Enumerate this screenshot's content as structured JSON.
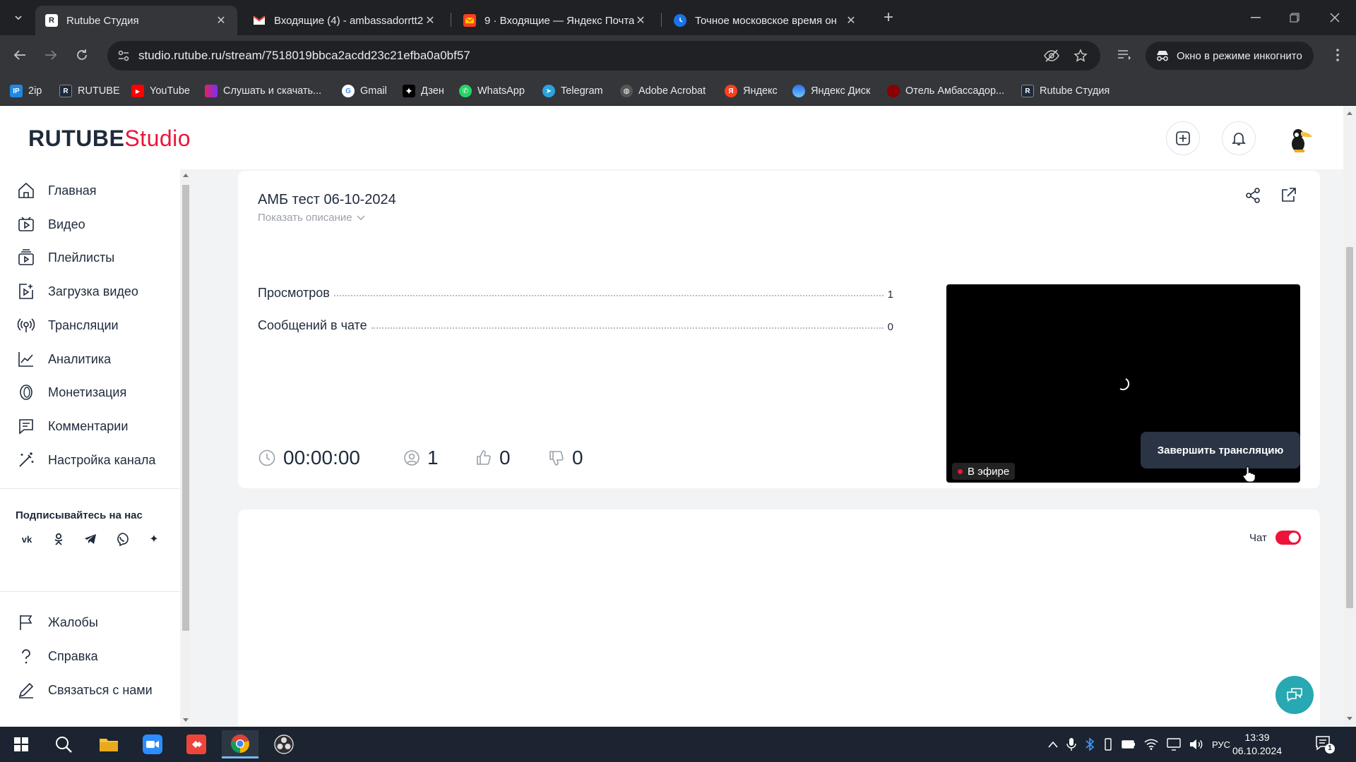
{
  "browser": {
    "tabs": [
      {
        "title": "Rutube Студия",
        "active": true
      },
      {
        "title": "Входящие (4) - ambassadorrtt2",
        "active": false
      },
      {
        "title": "9 · Входящие — Яндекс Почта",
        "active": false
      },
      {
        "title": "Точное московское время он",
        "active": false
      }
    ],
    "url": "studio.rutube.ru/stream/7518019bbca2acdd23c21efba0a0bf57",
    "incognito_label": "Окно в режиме инкогнито",
    "bookmarks": [
      "2ip",
      "RUTUBE",
      "YouTube",
      "Слушать и скачать...",
      "Gmail",
      "Дзен",
      "WhatsApp",
      "Telegram",
      "Adobe Acrobat",
      "Яндекс",
      "Яндекс Диск",
      "Отель Амбассадор...",
      "Rutube Студия"
    ]
  },
  "header": {
    "logo_main": "RUTUBE",
    "logo_accent": "Studio"
  },
  "sidebar": {
    "items": [
      {
        "label": "Главная",
        "icon": "home-icon"
      },
      {
        "label": "Видео",
        "icon": "video-icon"
      },
      {
        "label": "Плейлисты",
        "icon": "playlist-icon"
      },
      {
        "label": "Загрузка видео",
        "icon": "upload-icon"
      },
      {
        "label": "Трансляции",
        "icon": "broadcast-icon"
      },
      {
        "label": "Аналитика",
        "icon": "analytics-icon"
      },
      {
        "label": "Монетизация",
        "icon": "coin-icon"
      },
      {
        "label": "Комментарии",
        "icon": "comments-icon"
      },
      {
        "label": "Настройка канала",
        "icon": "wand-icon"
      }
    ],
    "subscribe_title": "Подписывайтесь на нас",
    "social": [
      "vk-icon",
      "odnoklassniki-icon",
      "telegram-icon",
      "viber-icon",
      "dzen-icon"
    ],
    "bottom_items": [
      {
        "label": "Жалобы",
        "icon": "flag-icon"
      },
      {
        "label": "Справка",
        "icon": "help-icon"
      },
      {
        "label": "Связаться с нами",
        "icon": "contact-icon"
      }
    ]
  },
  "stream": {
    "title": "АМБ тест 06-10-2024",
    "show_description": "Показать описание",
    "stats": [
      {
        "label": "Просмотров",
        "value": "1"
      },
      {
        "label": "Сообщений в чате",
        "value": "0"
      }
    ],
    "live_label": "В эфире",
    "duration": "00:00:00",
    "viewers": "1",
    "likes": "0",
    "dislikes": "0",
    "end_button": "Завершить трансляцию"
  },
  "chat": {
    "toggle_label": "Чат",
    "enabled": true
  },
  "taskbar": {
    "language": "РУС",
    "time": "13:39",
    "date": "06.10.2024",
    "notifications": "1"
  },
  "colors": {
    "accent": "#ed143b",
    "dark": "#2b3444",
    "fab": "#27a8b2"
  }
}
